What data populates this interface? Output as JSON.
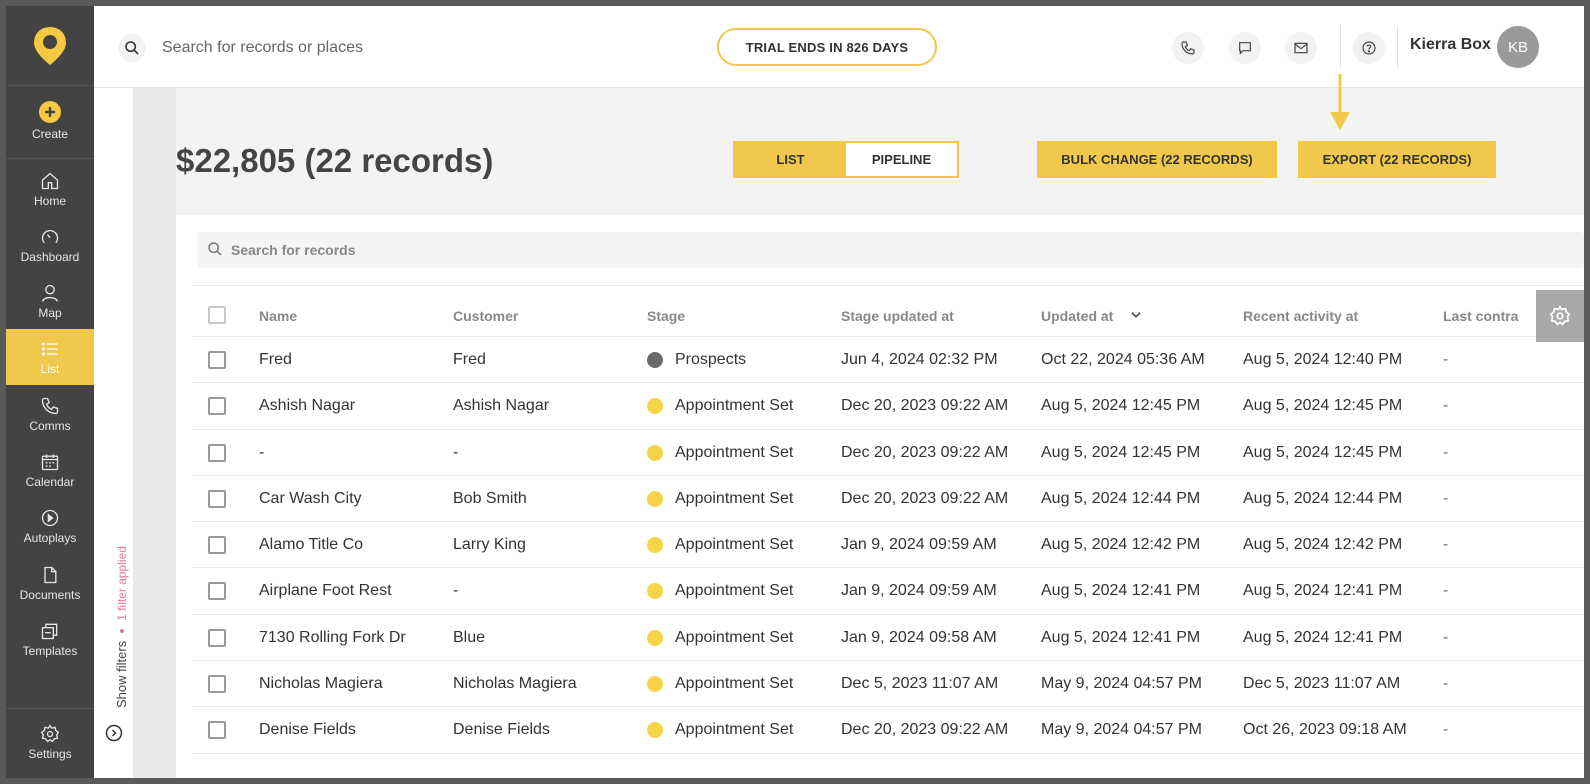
{
  "sidebar": {
    "items": [
      {
        "label": "Create",
        "icon": "plus-circle-icon"
      },
      {
        "label": "Home",
        "icon": "home-icon"
      },
      {
        "label": "Dashboard",
        "icon": "gauge-icon"
      },
      {
        "label": "Map",
        "icon": "person-pin-icon"
      },
      {
        "label": "List",
        "icon": "list-icon",
        "active": true
      },
      {
        "label": "Comms",
        "icon": "phone-icon"
      },
      {
        "label": "Calendar",
        "icon": "calendar-icon"
      },
      {
        "label": "Autoplays",
        "icon": "play-circle-icon"
      },
      {
        "label": "Documents",
        "icon": "document-icon"
      },
      {
        "label": "Templates",
        "icon": "templates-icon"
      },
      {
        "label": "Settings",
        "icon": "gear-icon"
      }
    ]
  },
  "topbar": {
    "search_placeholder": "Search for records or places",
    "trial_text": "TRIAL ENDS IN 826 DAYS",
    "user_name": "Kierra Box",
    "avatar_initials": "KB"
  },
  "filters": {
    "show_label": "Show filters",
    "applied_label": "1 filter applied"
  },
  "header": {
    "total": "$22,805 (22 records)",
    "view_list": "LIST",
    "view_pipeline": "PIPELINE",
    "bulk_change": "BULK CHANGE (22 RECORDS)",
    "export": "EXPORT (22 RECORDS)"
  },
  "records": {
    "search_placeholder": "Search for records",
    "columns": [
      "Name",
      "Customer",
      "Stage",
      "Stage updated at",
      "Updated at",
      "Recent activity at",
      "Last contra"
    ],
    "rows": [
      {
        "name": "Fred",
        "customer": "Fred",
        "stage": "Prospects",
        "stage_color": "#6b6b6b",
        "stage_updated": "Jun 4, 2024 02:32 PM",
        "updated": "Oct 22, 2024 05:36 AM",
        "recent": "Aug 5, 2024 12:40 PM",
        "last": "-"
      },
      {
        "name": "Ashish Nagar",
        "customer": "Ashish Nagar",
        "stage": "Appointment Set",
        "stage_color": "#f5d547",
        "stage_updated": "Dec 20, 2023 09:22 AM",
        "updated": "Aug 5, 2024 12:45 PM",
        "recent": "Aug 5, 2024 12:45 PM",
        "last": "-"
      },
      {
        "name": "-",
        "customer": "-",
        "stage": "Appointment Set",
        "stage_color": "#f5d547",
        "stage_updated": "Dec 20, 2023 09:22 AM",
        "updated": "Aug 5, 2024 12:45 PM",
        "recent": "Aug 5, 2024 12:45 PM",
        "last": "-"
      },
      {
        "name": "Car Wash City",
        "customer": "Bob Smith",
        "stage": "Appointment Set",
        "stage_color": "#f5d547",
        "stage_updated": "Dec 20, 2023 09:22 AM",
        "updated": "Aug 5, 2024 12:44 PM",
        "recent": "Aug 5, 2024 12:44 PM",
        "last": "-"
      },
      {
        "name": "Alamo Title Co",
        "customer": "Larry King",
        "stage": "Appointment Set",
        "stage_color": "#f5d547",
        "stage_updated": "Jan 9, 2024 09:59 AM",
        "updated": "Aug 5, 2024 12:42 PM",
        "recent": "Aug 5, 2024 12:42 PM",
        "last": "-"
      },
      {
        "name": "Airplane Foot Rest",
        "customer": "-",
        "stage": "Appointment Set",
        "stage_color": "#f5d547",
        "stage_updated": "Jan 9, 2024 09:59 AM",
        "updated": "Aug 5, 2024 12:41 PM",
        "recent": "Aug 5, 2024 12:41 PM",
        "last": "-"
      },
      {
        "name": "7130 Rolling Fork Dr",
        "customer": "Blue",
        "stage": "Appointment Set",
        "stage_color": "#f5d547",
        "stage_updated": "Jan 9, 2024 09:58 AM",
        "updated": "Aug 5, 2024 12:41 PM",
        "recent": "Aug 5, 2024 12:41 PM",
        "last": "-"
      },
      {
        "name": "Nicholas Magiera",
        "customer": "Nicholas Magiera",
        "stage": "Appointment Set",
        "stage_color": "#f5d547",
        "stage_updated": "Dec 5, 2023 11:07 AM",
        "updated": "May 9, 2024 04:57 PM",
        "recent": "Dec 5, 2023 11:07 AM",
        "last": "-"
      },
      {
        "name": "Denise Fields",
        "customer": "Denise Fields",
        "stage": "Appointment Set",
        "stage_color": "#f5d547",
        "stage_updated": "Dec 20, 2023 09:22 AM",
        "updated": "May 9, 2024 04:57 PM",
        "recent": "Oct 26, 2023 09:18 AM",
        "last": "-"
      }
    ]
  },
  "colors": {
    "accent": "#f0c84b",
    "sidebar": "#434343"
  }
}
